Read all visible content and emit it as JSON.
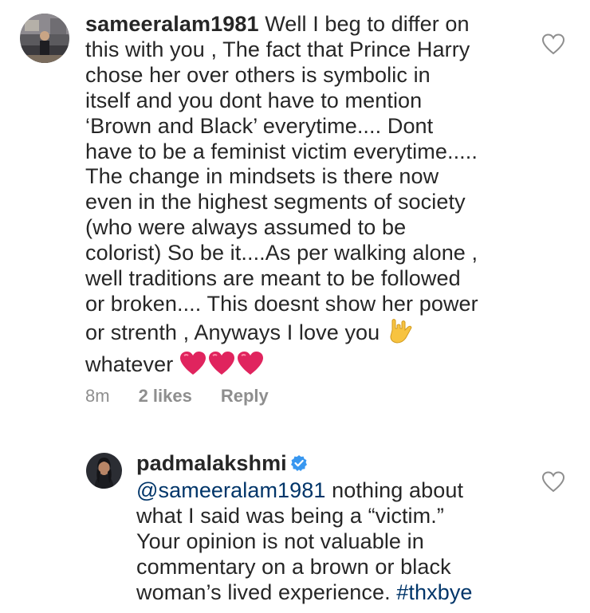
{
  "comments": [
    {
      "username": "sameeralam1981",
      "text_lines": [
        "Well I beg to differ on",
        "this with you , The fact that Prince Harry",
        "chose her over others is symbolic in",
        "itself and you dont have to mention",
        "‘Brown and Black’ everytime.... Dont",
        "have to be a feminist victim everytime.....",
        "The change in mindsets is there now",
        "even in the highest segments of society",
        "(who were always assumed to be",
        "colorist) So be it....As per walking alone ,",
        "well traditions are meant to be followed",
        "or broken.... This doesnt show her power",
        "or strenth , Anyways I love you",
        "whatever"
      ],
      "emojis": {
        "love_you_gesture": "love-you-gesture-emoji",
        "hearts": [
          "red-heart-emoji",
          "red-heart-emoji",
          "red-heart-emoji"
        ]
      },
      "time": "8m",
      "likes": "2 likes",
      "reply_label": "Reply"
    },
    {
      "username": "padmalakshmi",
      "verified": true,
      "mention": "@sameeralam1981",
      "text_first": " nothing about",
      "text_lines": [
        "what I said was being a “victim.”",
        "Your opinion is not valuable in",
        "commentary on a brown or black",
        "woman’s lived experience."
      ],
      "hashtag": "#thxbye"
    }
  ],
  "colors": {
    "text": "#262626",
    "meta": "#8e8e8e",
    "link": "#003569",
    "verified": "#3897f0",
    "heart_emoji": "#e0245e",
    "like_outline": "#8e8e8e"
  },
  "icons": {
    "like": "heart-outline-icon",
    "verified": "verified-badge-icon"
  }
}
